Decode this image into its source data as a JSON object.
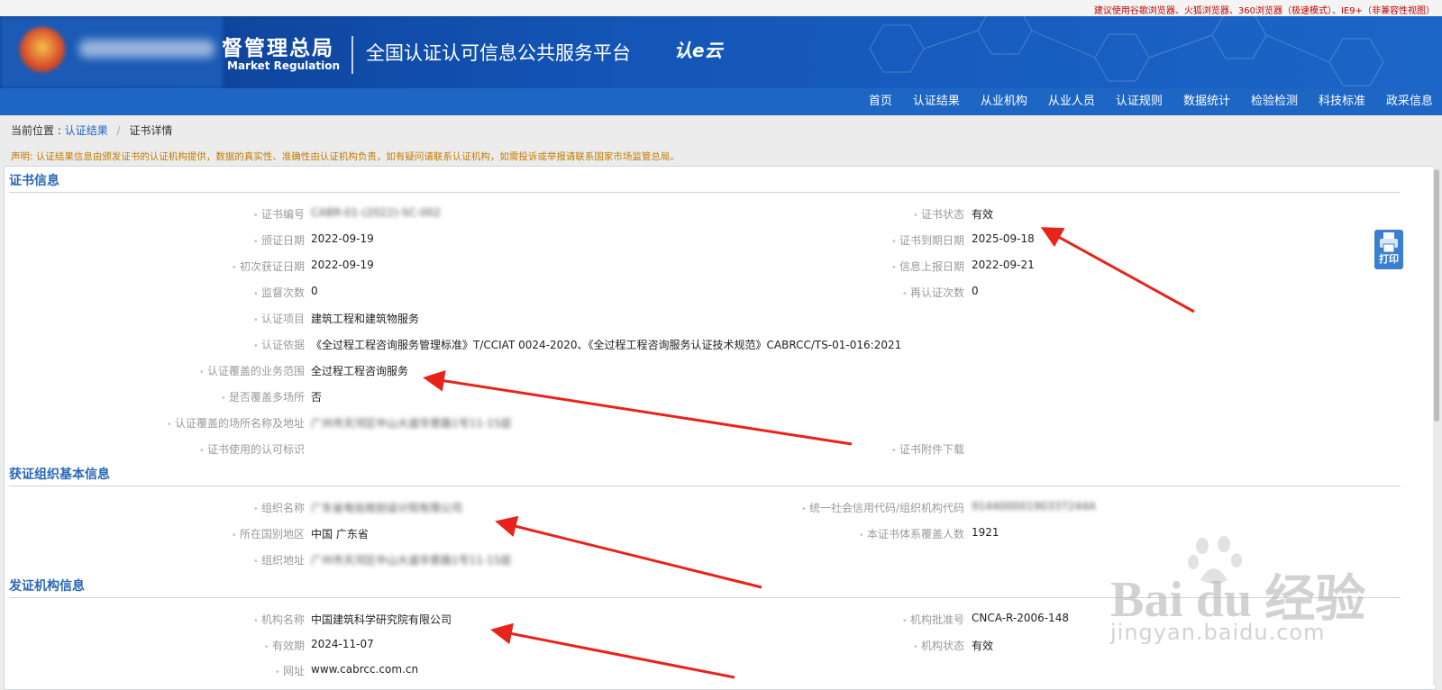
{
  "browser_tip": "建议使用谷歌浏览器、火狐浏览器、360浏览器（极速模式）、IE9+（非兼容性视图）",
  "header": {
    "agency_cn": "督管理总局",
    "agency_en": "Market Regulation",
    "platform": "全国认证认可信息公共服务平台",
    "cloud_logo": "认e云"
  },
  "nav": [
    "首页",
    "认证结果",
    "从业机构",
    "从业人员",
    "认证规则",
    "数据统计",
    "检验检测",
    "科技标准",
    "政采信息"
  ],
  "breadcrumb": {
    "prefix": "当前位置 :",
    "link": "认证结果",
    "sep": "/",
    "current": "证书详情"
  },
  "notice": "声明: 认证结果信息由颁发证书的认证机构提供，数据的真实性、准确性由认证机构负责，如有疑问请联系认证机构，如需投诉或举报请联系国家市场监管总局。",
  "sections": {
    "cert_info": "证书信息",
    "org_info": "获证组织基本信息",
    "issuer_info": "发证机构信息"
  },
  "cert": {
    "number_label": "证书编号",
    "number": "CABR-01-(2022)-SC-002",
    "status_label": "证书状态",
    "status": "有效",
    "issue_date_label": "颁证日期",
    "issue_date": "2022-09-19",
    "expire_label": "证书到期日期",
    "expire": "2025-09-18",
    "first_label": "初次获证日期",
    "first": "2022-09-19",
    "report_label": "信息上报日期",
    "report": "2022-09-21",
    "supervision_label": "监督次数",
    "supervision": "0",
    "recert_label": "再认证次数",
    "recert": "0",
    "item_label": "认证项目",
    "item": "建筑工程和建筑物服务",
    "basis_label": "认证依据",
    "basis": "《全过程工程咨询服务管理标准》T/CCIAT 0024-2020、《全过程工程咨询服务认证技术规范》CABRCC/TS-01-016:2021",
    "scope_label": "认证覆盖的业务范围",
    "scope": "全过程工程咨询服务",
    "multisite_label": "是否覆盖多场所",
    "multisite": "否",
    "site_label": "认证覆盖的场所名称及地址",
    "site": "广州市天河区中山大道华景路1号11-15层",
    "mark_label": "证书使用的认可标识",
    "attach_label": "证书附件下载"
  },
  "org": {
    "name_label": "组织名称",
    "name": "广东省电信规划设计院有限公司",
    "credit_label": "统一社会信用代码/组织机构代码",
    "credit": "91440000190337244A",
    "region_label": "所在国别地区",
    "region": "中国 广东省",
    "people_label": "本证书体系覆盖人数",
    "people": "1921",
    "addr_label": "组织地址",
    "addr": "广州市天河区中山大道华景路1号11-15层"
  },
  "issuer": {
    "name_label": "机构名称",
    "name": "中国建筑科学研究院有限公司",
    "approval_label": "机构批准号",
    "approval": "CNCA-R-2006-148",
    "valid_label": "有效期",
    "valid": "2024-11-07",
    "status_label": "机构状态",
    "status": "有效",
    "site_label": "网址",
    "site": "www.cabrcc.com.cn"
  },
  "print_label": "打印",
  "watermark": {
    "main": "Bai du 经验",
    "sub": "jingyan.baidu.com"
  },
  "colors": {
    "nav": "#1d66c4",
    "banner": "#0b3d91",
    "notice": "#c47a00",
    "section_title": "#2a67b6",
    "arrow": "#e8231c"
  }
}
